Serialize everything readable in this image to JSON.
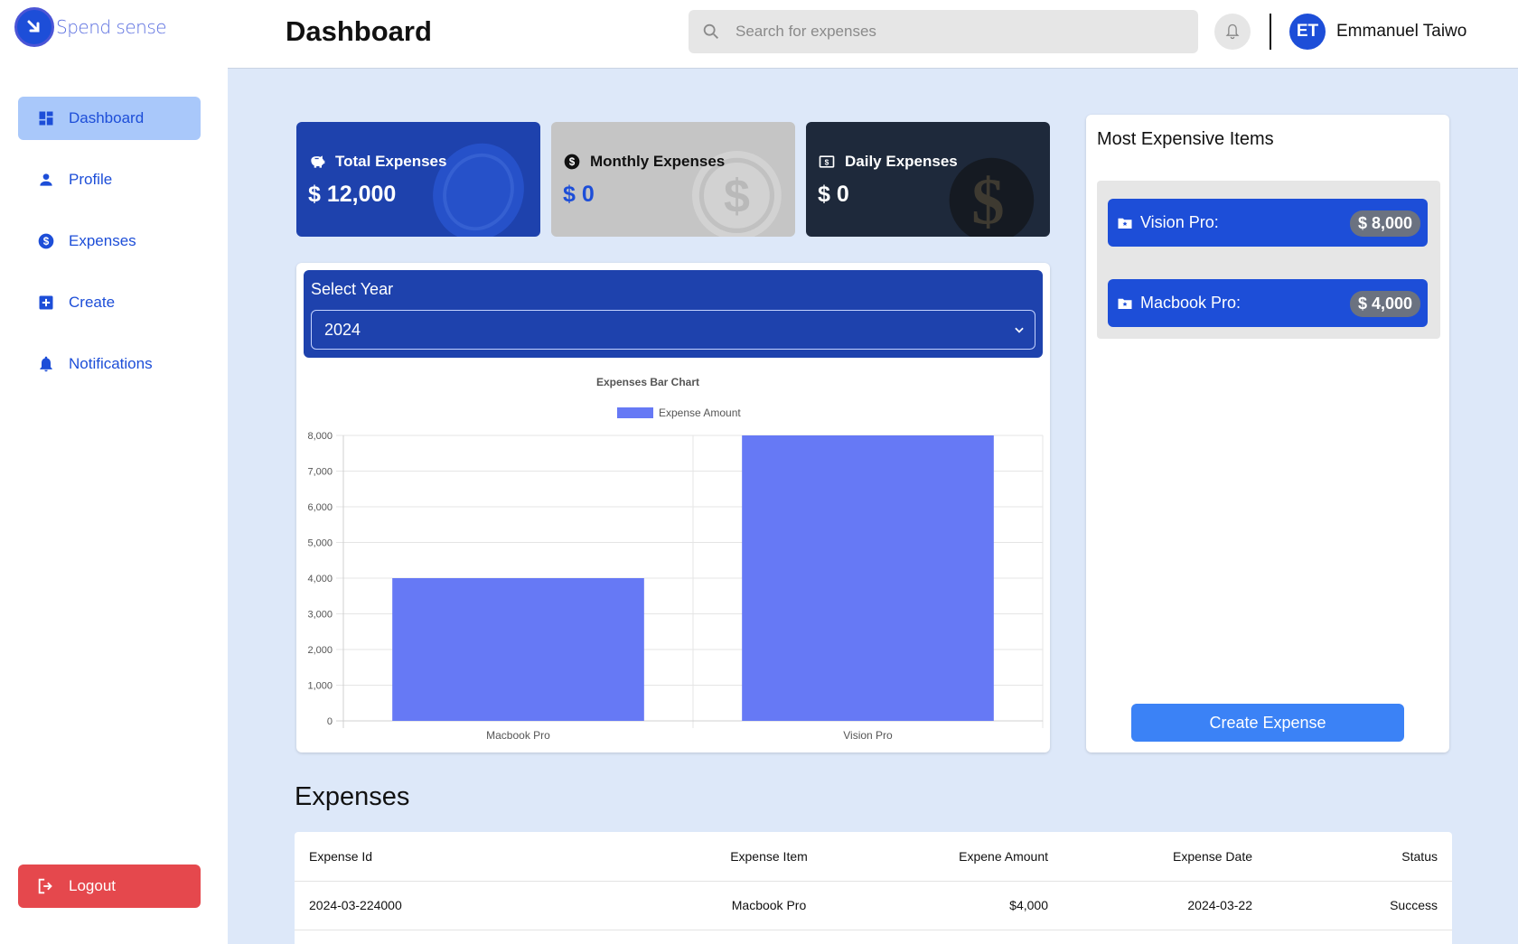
{
  "app": {
    "logo_text": "Spend sense"
  },
  "sidebar": {
    "items": [
      {
        "label": "Dashboard",
        "icon": "dashboard-icon",
        "active": true
      },
      {
        "label": "Profile",
        "icon": "person-icon"
      },
      {
        "label": "Expenses",
        "icon": "dollar-circle-icon"
      },
      {
        "label": "Create",
        "icon": "plus-square-icon"
      },
      {
        "label": "Notifications",
        "icon": "bell-icon"
      }
    ],
    "logout_label": "Logout"
  },
  "header": {
    "title": "Dashboard",
    "search_placeholder": "Search for expenses",
    "user_initials": "ET",
    "user_name": "Emmanuel Taiwo"
  },
  "stats": {
    "total": {
      "label": "Total Expenses",
      "value": "$ 12,000"
    },
    "monthly": {
      "label": "Monthly Expenses",
      "value": "$ 0"
    },
    "daily": {
      "label": "Daily Expenses",
      "value": "$ 0"
    }
  },
  "year_filter": {
    "label": "Select Year",
    "selected": "2024"
  },
  "chart_data": {
    "type": "bar",
    "title": "Expenses Bar Chart",
    "categories": [
      "Macbook Pro",
      "Vision Pro"
    ],
    "series": [
      {
        "name": "Expense Amount",
        "values": [
          4000,
          8000
        ],
        "color": "#6679f5"
      }
    ],
    "ylim": [
      0,
      8000
    ],
    "yticks": [
      0,
      1000,
      2000,
      3000,
      4000,
      5000,
      6000,
      7000,
      8000
    ],
    "ytick_labels": [
      "0",
      "1,000",
      "2,000",
      "3,000",
      "4,000",
      "5,000",
      "6,000",
      "7,000",
      "8,000"
    ],
    "grid": true,
    "legend": "top"
  },
  "most_expensive": {
    "title": "Most Expensive Items",
    "items": [
      {
        "name": "Vision Pro:",
        "price": "$ 8,000"
      },
      {
        "name": "Macbook Pro:",
        "price": "$ 4,000"
      }
    ],
    "create_label": "Create Expense"
  },
  "expenses": {
    "title": "Expenses",
    "columns": [
      "Expense Id",
      "Expense Item",
      "Expene Amount",
      "Expense Date",
      "Status"
    ],
    "rows": [
      [
        "2024-03-224000",
        "Macbook Pro",
        "$4,000",
        "2024-03-22",
        "Success"
      ]
    ]
  },
  "colors": {
    "brand": "#1d4ed8",
    "sidebar_active": "#a9c8fa",
    "logout": "#e5484d",
    "bar": "#6679f5",
    "background": "#dde8f9"
  }
}
